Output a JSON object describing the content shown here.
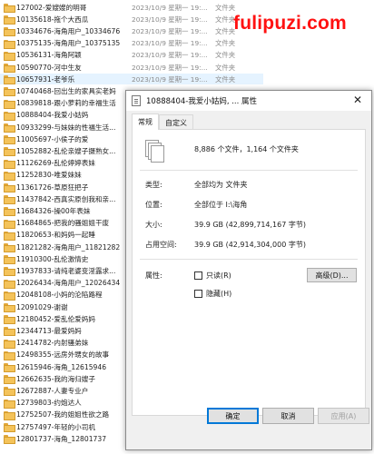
{
  "watermark": "fulipuzi.com",
  "files": [
    {
      "name": "127002-爱嫂嫂的明哥",
      "date": "2023/10/9 星期一 19:...",
      "type": "文件夹"
    },
    {
      "name": "10135618-拖个大西瓜",
      "date": "2023/10/9 星期一 19:...",
      "type": "文件夹"
    },
    {
      "name": "10334676-海角用户_10334676",
      "date": "2023/10/9 星期一 19:...",
      "type": "文件夹"
    },
    {
      "name": "10375135-海角用户_10375135",
      "date": "2023/10/9 星期一 19:...",
      "type": "文件夹"
    },
    {
      "name": "10536131-海角阿颖",
      "date": "2023/10/9 星期一 19:...",
      "type": "文件夹"
    },
    {
      "name": "10590770-河中生友",
      "date": "2023/10/9 星期一 19:...",
      "type": "文件夹"
    },
    {
      "name": "10657931-老爷乐",
      "date": "2023/10/9 星期一 19:...",
      "type": "文件夹"
    },
    {
      "name": "10740468-回出生的家具实老妈",
      "date": "",
      "type": ""
    },
    {
      "name": "10839818-跟小萝莉的幸福生活",
      "date": "",
      "type": ""
    },
    {
      "name": "10888404-我爱小姑妈",
      "date": "",
      "type": ""
    },
    {
      "name": "10933299-与妹妹的性福生活...",
      "date": "",
      "type": ""
    },
    {
      "name": "11005697-小侯子的爱",
      "date": "",
      "type": ""
    },
    {
      "name": "11052882-乱伦亲嫂子摄熟女...",
      "date": "",
      "type": ""
    },
    {
      "name": "11126269-乱伦婷婷表妹",
      "date": "",
      "type": ""
    },
    {
      "name": "11252830-唯爱妹妹",
      "date": "",
      "type": ""
    },
    {
      "name": "11361726-草原狂把子",
      "date": "",
      "type": ""
    },
    {
      "name": "11437842-西真实原创我和亲...",
      "date": "",
      "type": ""
    },
    {
      "name": "11684326-操00年表妹",
      "date": "",
      "type": ""
    },
    {
      "name": "11684865-把我的骚姐姐干废",
      "date": "",
      "type": ""
    },
    {
      "name": "11820653-和妈妈一起睡",
      "date": "",
      "type": ""
    },
    {
      "name": "11821282-海角用户_11821282",
      "date": "",
      "type": ""
    },
    {
      "name": "11910300-乱伦激情史",
      "date": "",
      "type": ""
    },
    {
      "name": "11937833-请纯老婆变淫露求...",
      "date": "",
      "type": ""
    },
    {
      "name": "12026434-海角用户_12026434",
      "date": "",
      "type": ""
    },
    {
      "name": "12048108-小妈的沦陷路程",
      "date": "",
      "type": ""
    },
    {
      "name": "12091029-谢谢",
      "date": "",
      "type": ""
    },
    {
      "name": "12180452-爱乱伦爱妈妈",
      "date": "",
      "type": ""
    },
    {
      "name": "12344713-最爱妈妈",
      "date": "",
      "type": ""
    },
    {
      "name": "12414782-内射骚弟妹",
      "date": "",
      "type": ""
    },
    {
      "name": "12498355-远房外甥女的故事",
      "date": "",
      "type": ""
    },
    {
      "name": "12615946-海角_12615946",
      "date": "",
      "type": ""
    },
    {
      "name": "12662635-我的海归嫂子",
      "date": "",
      "type": ""
    },
    {
      "name": "12672887-人妻专业户",
      "date": "",
      "type": ""
    },
    {
      "name": "12739803-约炮达人",
      "date": "",
      "type": ""
    },
    {
      "name": "12752507-我的姐姐性欲之路",
      "date": "",
      "type": ""
    },
    {
      "name": "12757497-年轻的小司机",
      "date": "2023/10/9 星期一 19:...",
      "type": "文件夹"
    },
    {
      "name": "12801737-海角_12801737",
      "date": "2023/10/9 星期一 19:...",
      "type": "文件夹"
    }
  ],
  "dialog": {
    "title": "10888404-我爱小姑妈, ... 属性",
    "close_glyph": "✕",
    "tabs": [
      "常规",
      "自定义"
    ],
    "count_text": "8,886 个文件，1,164 个文件夹",
    "rows": {
      "type_label": "类型:",
      "type_value": "全部均为 文件夹",
      "location_label": "位置:",
      "location_value": "全部位于 I:\\海角",
      "size_label": "大小:",
      "size_value": "39.9 GB (42,899,714,167 字节)",
      "disk_label": "占用空间:",
      "disk_value": "39.9 GB (42,914,304,000 字节)",
      "attr_label": "属性:"
    },
    "attributes": {
      "readonly": "只读(R)",
      "hidden": "隐藏(H)",
      "advanced": "高级(D)..."
    },
    "buttons": {
      "ok": "确定",
      "cancel": "取消",
      "apply": "应用(A)"
    }
  }
}
